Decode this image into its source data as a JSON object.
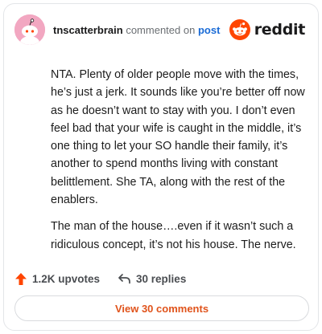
{
  "header": {
    "username": "tnscatterbrain",
    "commented_text": "commented on",
    "post_link": "post",
    "logo_text": "reddit"
  },
  "comment": {
    "paragraphs": [
      "NTA. Plenty of older people move with the times, he’s just a jerk. It sounds like you’re better off now as he doesn’t want to stay with you. I don’t even feel bad that your wife is caught in the middle, it’s one thing to let your SO handle their family, it’s another to spend months living with constant belittlement. She TA, along with the rest of the enablers.",
      "The man of the house….even if it wasn’t such a ridiculous concept, it’s not his house. The nerve."
    ]
  },
  "actions": {
    "upvotes": "1.2K upvotes",
    "replies": "30 replies"
  },
  "view_button": "View 30 comments",
  "colors": {
    "brand": "#ff4500",
    "link": "#1a6bd6",
    "view_button_text": "#e0531b",
    "avatar_bg": "#f2a7c1"
  },
  "icons": {
    "avatar": "snoo-avatar",
    "logo": "reddit-snoo-icon",
    "upvote": "upvote-arrow-icon",
    "reply": "reply-arrow-icon"
  }
}
